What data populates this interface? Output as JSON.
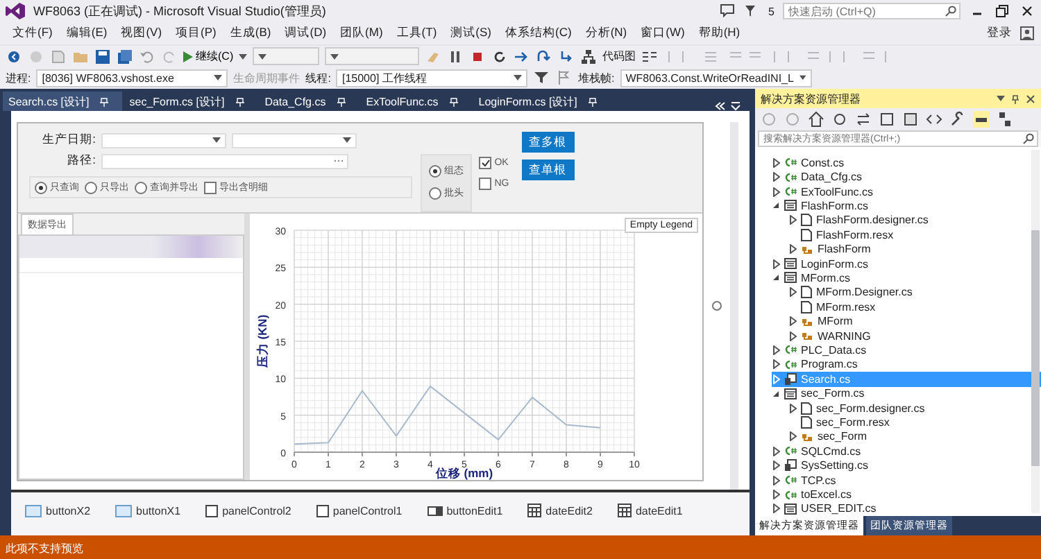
{
  "window": {
    "title": "WF8063 (正在调试) - Microsoft Visual Studio(管理员)",
    "notifications": "5",
    "quick_launch": {
      "placeholder": "快速启动 (Ctrl+Q)"
    },
    "sign_in": "登录"
  },
  "menu": [
    "文件(F)",
    "编辑(E)",
    "视图(V)",
    "项目(P)",
    "生成(B)",
    "调试(D)",
    "团队(M)",
    "工具(T)",
    "测试(S)",
    "体系结构(C)",
    "分析(N)",
    "窗口(W)",
    "帮助(H)"
  ],
  "toolbar": {
    "continue": "继续(C)",
    "code_map": "代码图"
  },
  "debug_location": {
    "process_label": "进程:",
    "process": "[8036] WF8063.vshost.exe",
    "lifecycle": "生命周期事件",
    "thread_label": "线程:",
    "thread": "[15000] 工作线程",
    "stack_label": "堆栈帧:",
    "stack": "WF8063.Const.WriteOrReadINI_L"
  },
  "tabs": [
    {
      "label": "Search.cs [设计]",
      "selected": true
    },
    {
      "label": "sec_Form.cs [设计]",
      "selected": false
    },
    {
      "label": "Data_Cfg.cs",
      "selected": false
    },
    {
      "label": "ExToolFunc.cs",
      "selected": false
    },
    {
      "label": "LoginForm.cs [设计]",
      "selected": false
    }
  ],
  "form": {
    "date_label": "生产日期:",
    "path_label": "路径:",
    "query_modes": [
      {
        "label": "只查询",
        "selected": true
      },
      {
        "label": "只导出",
        "selected": false
      },
      {
        "label": "查询并导出",
        "selected": false
      }
    ],
    "export_detail": {
      "label": "导出含明细",
      "checked": false
    },
    "sources": [
      {
        "label": "组态",
        "selected": true
      },
      {
        "label": "批头",
        "selected": false
      }
    ],
    "result_filters": [
      {
        "label": "OK",
        "checked": true
      },
      {
        "label": "NG",
        "checked": false
      }
    ],
    "buttons": [
      "查多根",
      "查单根"
    ],
    "panel_tab": "数据导出",
    "chart": {
      "legend": "Empty Legend",
      "chart_data": {
        "type": "line",
        "xlabel": "位移 (mm)",
        "ylabel": "压力 (KN)",
        "x": [
          0,
          1,
          2,
          3,
          4,
          5,
          6,
          7,
          8,
          9
        ],
        "series": [
          {
            "color": "#a9b9cc",
            "values": [
              1.1,
              1.3,
              8.3,
              2.2,
              8.9,
              5.3,
              1.7,
              7.4,
              3.7,
              3.3
            ]
          }
        ],
        "xlim": [
          0,
          10
        ],
        "ylim": [
          0,
          30
        ],
        "xticks": [
          0,
          1,
          2,
          3,
          4,
          5,
          6,
          7,
          8,
          9,
          10
        ],
        "yticks": [
          0,
          5,
          10,
          15,
          20,
          25,
          30
        ],
        "grid": true
      }
    }
  },
  "tray": [
    {
      "kind": "button",
      "label": "buttonX2"
    },
    {
      "kind": "button",
      "label": "buttonX1"
    },
    {
      "kind": "panel",
      "label": "panelControl2"
    },
    {
      "kind": "panel",
      "label": "panelControl1"
    },
    {
      "kind": "buttonedit",
      "label": "buttonEdit1"
    },
    {
      "kind": "dateedit",
      "label": "dateEdit2"
    },
    {
      "kind": "dateedit",
      "label": "dateEdit1"
    }
  ],
  "solution_explorer": {
    "title": "解决方案资源管理器",
    "search": {
      "placeholder": "搜索解决方案资源管理器(Ctrl+;)"
    },
    "items": [
      {
        "kind": "cs",
        "label": "Const.cs",
        "expanded": false,
        "selected": false
      },
      {
        "kind": "cs",
        "label": "Data_Cfg.cs",
        "expanded": false,
        "selected": false
      },
      {
        "kind": "cs",
        "label": "ExToolFunc.cs",
        "expanded": false,
        "selected": false
      },
      {
        "kind": "form",
        "label": "FlashForm.cs",
        "expanded": true,
        "selected": false,
        "children": [
          {
            "kind": "designer",
            "label": "FlashForm.designer.cs",
            "expanded": false,
            "selected": false
          },
          {
            "kind": "resx",
            "label": "FlashForm.resx",
            "selected": false
          },
          {
            "kind": "class",
            "label": "FlashForm",
            "expanded": false,
            "selected": false
          }
        ]
      },
      {
        "kind": "form",
        "label": "LoginForm.cs",
        "expanded": false,
        "selected": false
      },
      {
        "kind": "form",
        "label": "MForm.cs",
        "expanded": true,
        "selected": false,
        "children": [
          {
            "kind": "designer",
            "label": "MForm.Designer.cs",
            "expanded": false,
            "selected": false
          },
          {
            "kind": "resx",
            "label": "MForm.resx",
            "selected": false
          },
          {
            "kind": "class",
            "label": "MForm",
            "expanded": false,
            "selected": false
          },
          {
            "kind": "class",
            "label": "WARNING",
            "expanded": false,
            "selected": false
          }
        ]
      },
      {
        "kind": "cs",
        "label": "PLC_Data.cs",
        "expanded": false,
        "selected": false
      },
      {
        "kind": "cs",
        "label": "Program.cs",
        "expanded": false,
        "selected": false
      },
      {
        "kind": "component",
        "label": "Search.cs",
        "expanded": false,
        "selected": true
      },
      {
        "kind": "form",
        "label": "sec_Form.cs",
        "expanded": true,
        "selected": false,
        "children": [
          {
            "kind": "designer",
            "label": "sec_Form.designer.cs",
            "expanded": false,
            "selected": false
          },
          {
            "kind": "resx",
            "label": "sec_Form.resx",
            "selected": false
          },
          {
            "kind": "class",
            "label": "sec_Form",
            "expanded": false,
            "selected": false
          }
        ]
      },
      {
        "kind": "cs",
        "label": "SQLCmd.cs",
        "expanded": false,
        "selected": false
      },
      {
        "kind": "component",
        "label": "SysSetting.cs",
        "expanded": false,
        "selected": false
      },
      {
        "kind": "cs",
        "label": "TCP.cs",
        "expanded": false,
        "selected": false
      },
      {
        "kind": "cs",
        "label": "toExcel.cs",
        "expanded": false,
        "selected": false
      },
      {
        "kind": "form",
        "label": "USER_EDIT.cs",
        "expanded": false,
        "selected": false
      }
    ],
    "bottom_tabs": [
      {
        "label": "解决方案资源管理器",
        "selected": true
      },
      {
        "label": "团队资源管理器",
        "selected": false
      }
    ]
  },
  "status_bar": "此项不支持预览"
}
